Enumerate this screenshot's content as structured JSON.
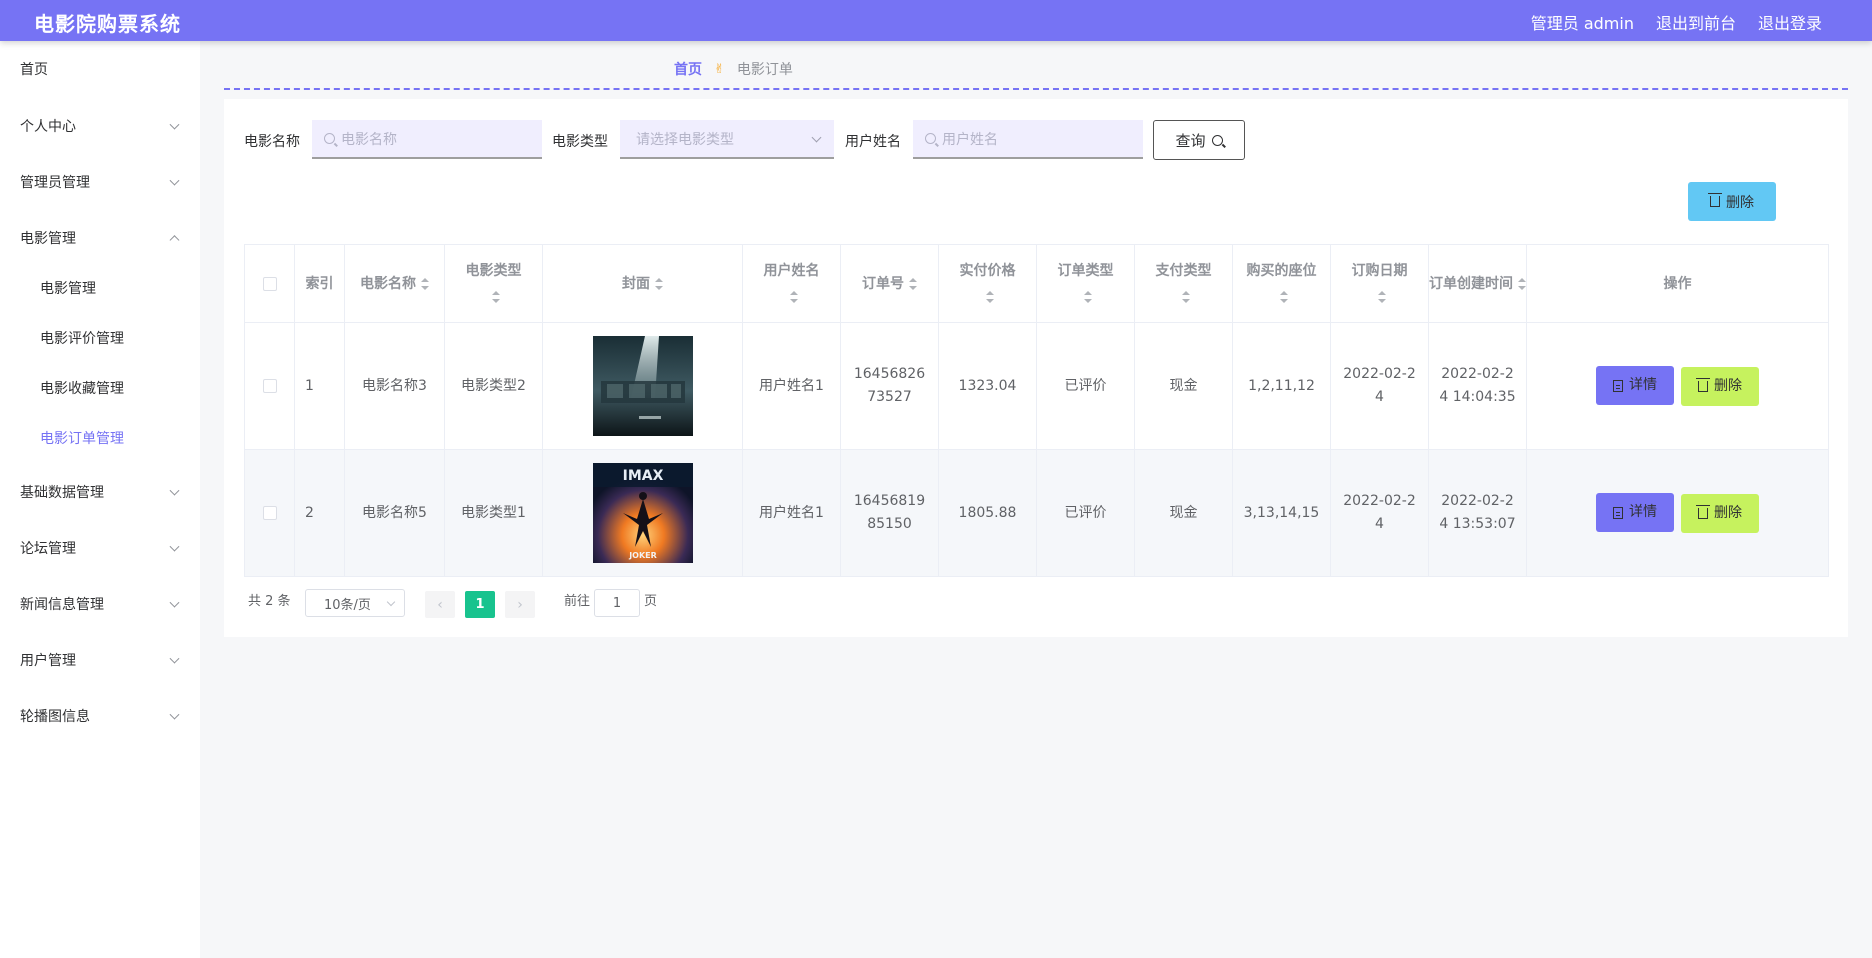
{
  "header": {
    "app_title": "电影院购票系统",
    "admin_label": "管理员 admin",
    "frontend_link": "退出到前台",
    "logout_link": "退出登录"
  },
  "sidebar": {
    "items": [
      {
        "label": "首页"
      },
      {
        "label": "个人中心"
      },
      {
        "label": "管理员管理"
      },
      {
        "label": "电影管理",
        "expanded": true
      },
      {
        "label": "基础数据管理"
      },
      {
        "label": "论坛管理"
      },
      {
        "label": "新闻信息管理"
      },
      {
        "label": "用户管理"
      },
      {
        "label": "轮播图信息"
      }
    ],
    "sub_items": [
      {
        "label": "电影管理"
      },
      {
        "label": "电影评价管理"
      },
      {
        "label": "电影收藏管理"
      },
      {
        "label": "电影订单管理",
        "active": true
      }
    ]
  },
  "breadcrumb": {
    "home": "首页",
    "separator_icon": "✌",
    "current": "电影订单"
  },
  "filters": {
    "movie_name_label": "电影名称",
    "movie_name_placeholder": "电影名称",
    "movie_type_label": "电影类型",
    "movie_type_placeholder": "请选择电影类型",
    "user_name_label": "用户姓名",
    "user_name_placeholder": "用户姓名",
    "query_label": "查询"
  },
  "toolbar": {
    "bulk_delete_label": "删除"
  },
  "table": {
    "columns": [
      "索引",
      "电影名称",
      "电影类型",
      "封面",
      "用户姓名",
      "订单号",
      "实付价格",
      "订单类型",
      "支付类型",
      "购买的座位",
      "订购日期",
      "订单创建时间",
      "操作"
    ],
    "rows": [
      {
        "index": "1",
        "movie_name": "电影名称3",
        "movie_type": "电影类型2",
        "cover": "poster-light-beam",
        "user_name": "用户姓名1",
        "order_no": "1645682673527",
        "price": "1323.04",
        "order_type": "已评价",
        "pay_type": "现金",
        "seats": "1,2,11,12",
        "order_date": "2022-02-24",
        "created_at": "2022-02-24 14:04:35"
      },
      {
        "index": "2",
        "movie_name": "电影名称5",
        "movie_type": "电影类型1",
        "cover": "poster-joker-imax",
        "user_name": "用户姓名1",
        "order_no": "1645681985150",
        "price": "1805.88",
        "order_type": "已评价",
        "pay_type": "现金",
        "seats": "3,13,14,15",
        "order_date": "2022-02-24",
        "created_at": "2022-02-24 13:53:07"
      }
    ],
    "detail_label": "详情",
    "delete_label": "删除"
  },
  "pagination": {
    "total_text": "共 2 条",
    "page_size": "10条/页",
    "current_page": "1",
    "goto_label": "前往",
    "goto_value": "1",
    "page_unit": "页"
  },
  "colors": {
    "primary": "#7673f4",
    "bulk_delete": "#62c8f4",
    "row_delete": "#c6f25e",
    "current_page": "#18c38e"
  }
}
